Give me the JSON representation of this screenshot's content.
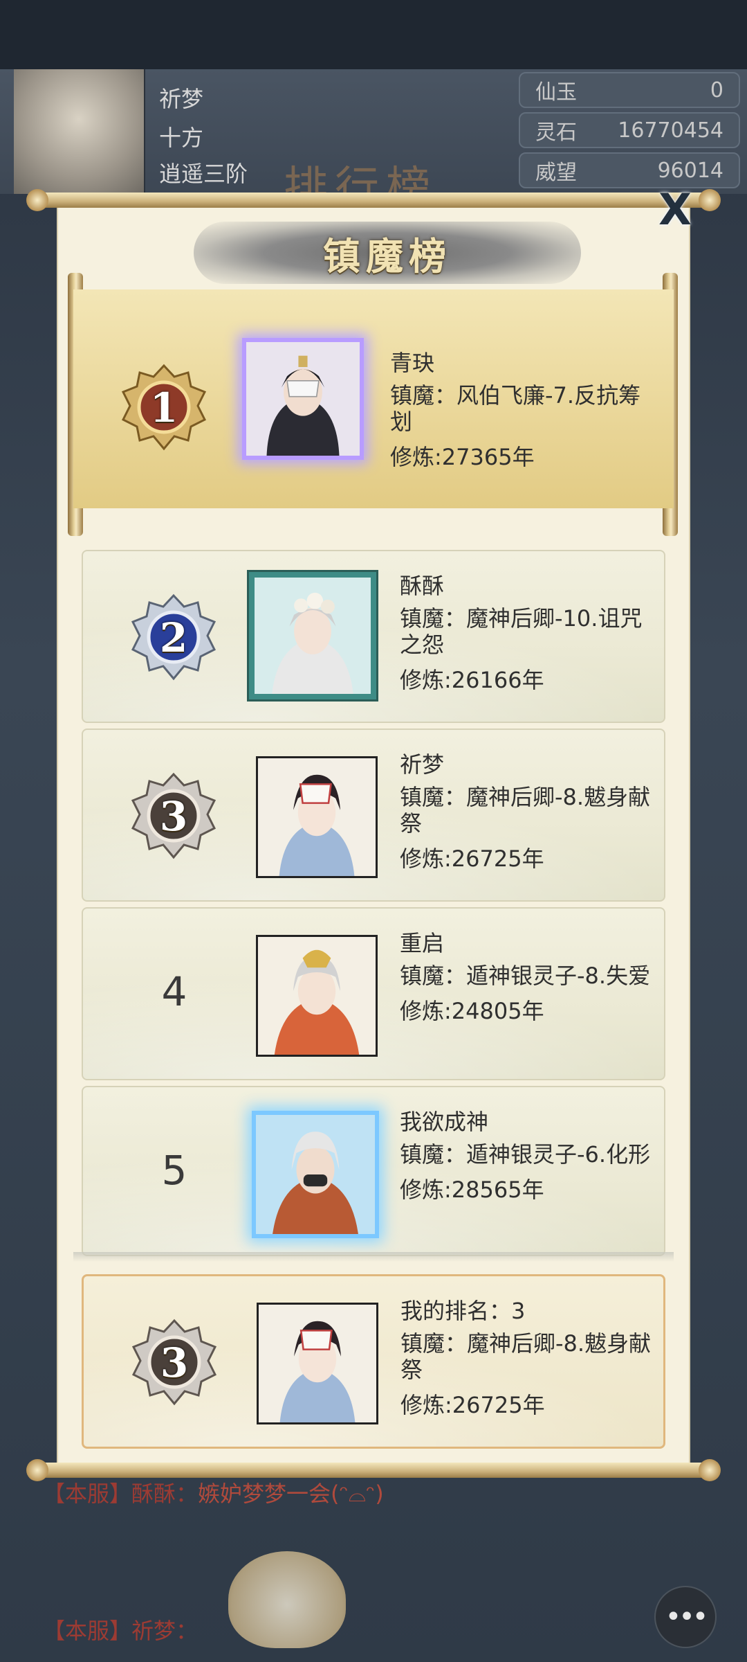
{
  "background": {
    "player": {
      "name": "祈梦",
      "realm": "十方",
      "level": "逍遥三阶"
    },
    "resources": [
      {
        "label": "仙玉",
        "value": "0"
      },
      {
        "label": "灵石",
        "value": "16770454"
      },
      {
        "label": "威望",
        "value": "96014"
      }
    ],
    "page_title": "排行榜",
    "chat": [
      {
        "channel": "【本服】",
        "sender": "酥酥：",
        "text": "嫉妒梦梦一会(ᵔ⌓ᵔ)"
      },
      {
        "channel": "【本服】",
        "sender": "祈梦：",
        "text": ""
      }
    ],
    "chat_button": "•••"
  },
  "modal": {
    "title": "镇魔榜",
    "close_label": "X",
    "entries": [
      {
        "rank": "1",
        "name": "青玦",
        "boss_line": "镇魔：风伯飞廉-7.反抗筹划",
        "years": "修炼:27365年",
        "frame": "purple",
        "medal_color": "#8e3a28"
      },
      {
        "rank": "2",
        "name": "酥酥",
        "boss_line": "镇魔：魔神后卿-10.诅咒之怨",
        "years": "修炼:26166年",
        "frame": "teal",
        "medal_color": "#2a3f9a"
      },
      {
        "rank": "3",
        "name": "祈梦",
        "boss_line": "镇魔：魔神后卿-8.魃身献祭",
        "years": "修炼:26725年",
        "frame": "plain",
        "medal_color": "#4a403a"
      },
      {
        "rank": "4",
        "name": "重启",
        "boss_line": "镇魔：遁神银灵子-8.失爱",
        "years": "修炼:24805年",
        "frame": "plain"
      },
      {
        "rank": "5",
        "name": "我欲成神",
        "boss_line": "镇魔：遁神银灵子-6.化形",
        "years": "修炼:28565年",
        "frame": "blue"
      }
    ],
    "my_rank": {
      "rank": "3",
      "name": "我的排名：3",
      "boss_line": "镇魔：魔神后卿-8.魃身献祭",
      "years": "修炼:26725年",
      "medal_color": "#4a403a"
    }
  }
}
